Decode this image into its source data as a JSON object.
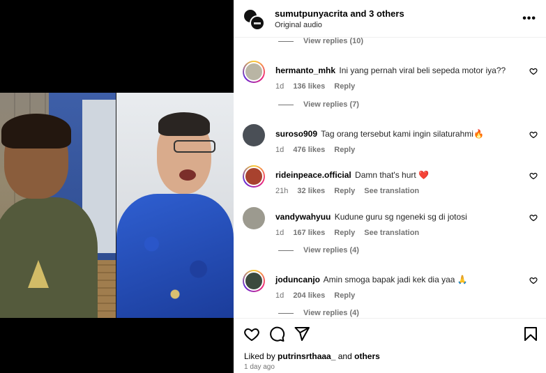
{
  "header": {
    "username": "sumutpunyacrita",
    "and_others": "and 3 others",
    "audio": "Original audio",
    "more_icon": "more-horizontal-icon"
  },
  "partial_view_replies": "View replies (10)",
  "comments": [
    {
      "username": "hermanto_mhk",
      "text": "Ini yang pernah viral beli sepeda motor iya??",
      "age": "1d",
      "likes": "136 likes",
      "reply": "Reply",
      "translation": "",
      "view_replies": "View replies (7)",
      "avatar_color": "#b9b5a4",
      "story_ring": true
    },
    {
      "username": "suroso909",
      "text": "Tag orang tersebut kami ingin silaturahmi",
      "emoji": "🔥",
      "age": "1d",
      "likes": "476 likes",
      "reply": "Reply",
      "translation": "",
      "view_replies": "",
      "avatar_color": "#4a4f56",
      "story_ring": false
    },
    {
      "username": "rideinpeace.official",
      "text": "Damn that's hurt",
      "emoji": "❤️",
      "age": "21h",
      "likes": "32 likes",
      "reply": "Reply",
      "translation": "See translation",
      "view_replies": "",
      "avatar_color": "#a8422e",
      "story_ring": true
    },
    {
      "username": "vandywahyuu",
      "text": "Kudune guru sg ngeneki sg di jotosi",
      "age": "1d",
      "likes": "167 likes",
      "reply": "Reply",
      "translation": "See translation",
      "view_replies": "View replies (4)",
      "avatar_color": "#9c9a8f",
      "story_ring": false
    },
    {
      "username": "joduncanjo",
      "text": "Amin smoga bapak jadi kek dia yaa",
      "emoji": "🙏",
      "age": "1d",
      "likes": "204 likes",
      "reply": "Reply",
      "translation": "",
      "view_replies": "View replies (4)",
      "avatar_color": "#3b4a3e",
      "story_ring": true
    }
  ],
  "actions": {
    "like_icon": "heart-icon",
    "comment_icon": "comment-icon",
    "share_icon": "send-icon",
    "save_icon": "bookmark-icon",
    "liked_by_prefix": "Liked by",
    "liked_by_user": "putrinsrthaaa_",
    "liked_by_suffix": "and",
    "liked_by_others": "others",
    "time_ago": "1 day ago"
  }
}
